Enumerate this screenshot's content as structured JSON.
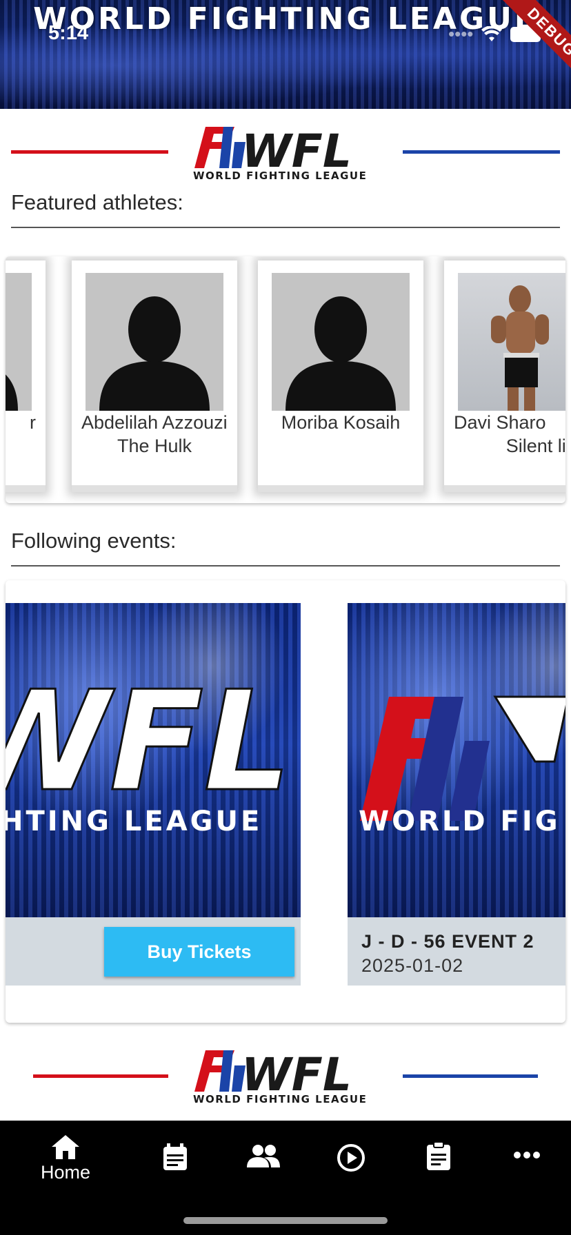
{
  "header": {
    "banner_title": "WORLD FIGHTING LEAGUE",
    "status_time": "5:14",
    "debug_label": "DEBUG"
  },
  "brand": {
    "logo_text": "WFL",
    "logo_subtitle": "WORLD FIGHTING LEAGUE",
    "red": "#d4101a",
    "blue": "#1b44a8"
  },
  "athletes": {
    "title": "Featured athletes:",
    "items": [
      {
        "name": "r",
        "nickname": ""
      },
      {
        "name": "Abdelilah Azzouzi",
        "nickname": "The Hulk"
      },
      {
        "name": "Moriba Kosaih",
        "nickname": ""
      },
      {
        "name": "Davi Sharo",
        "nickname": "Silent lic"
      }
    ]
  },
  "events": {
    "title": "Following events:",
    "items": [
      {
        "buy_label": "Buy Tickets",
        "banner_text": "WFL",
        "banner_subtitle": "HTING LEAGUE"
      },
      {
        "name": "J - D - 56 EVENT 2",
        "date": "2025-01-02",
        "banner_subtitle": "WORLD FIG"
      }
    ]
  },
  "nav": {
    "items": [
      {
        "label": "Home",
        "icon": "home-icon",
        "active": true
      },
      {
        "label": "",
        "icon": "calendar-icon"
      },
      {
        "label": "",
        "icon": "people-icon"
      },
      {
        "label": "",
        "icon": "play-circle-icon"
      },
      {
        "label": "",
        "icon": "clipboard-icon"
      },
      {
        "label": "",
        "icon": "more-horizontal-icon"
      }
    ]
  }
}
